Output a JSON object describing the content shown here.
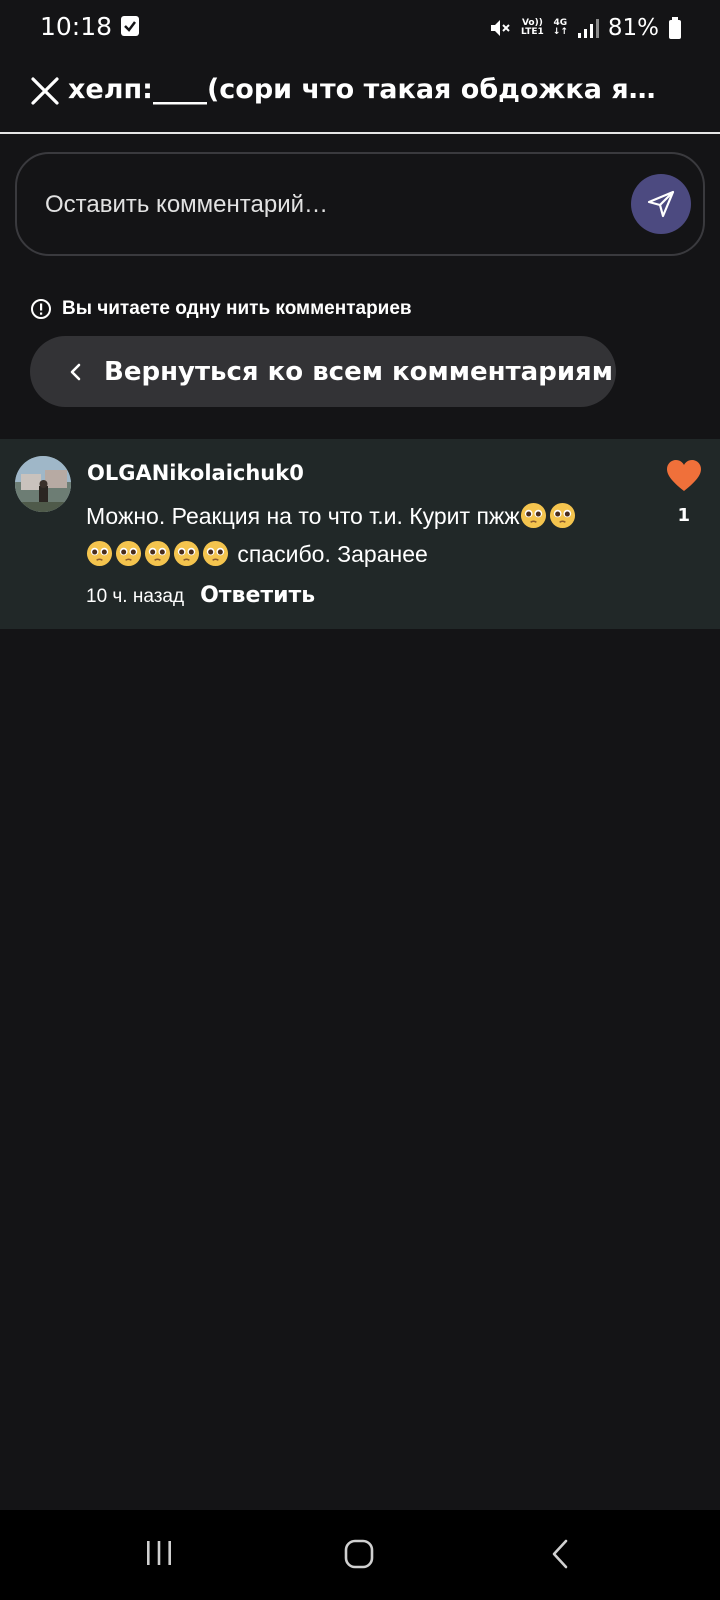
{
  "status_bar": {
    "time": "10:18",
    "network_top": "Vo))",
    "network_bottom": "LTE1",
    "gen": "4G",
    "battery": "81%"
  },
  "header": {
    "title": "хелп:____(сори что такая обдожка я…",
    "close_icon": "close-icon"
  },
  "comment_input": {
    "placeholder": "Оставить комментарий…"
  },
  "thread_notice": {
    "text": "Вы читаете одну нить комментариев"
  },
  "back_button": {
    "label": "Вернуться ко всем комментариям"
  },
  "comment": {
    "username": "OLGANikolaichuk0",
    "text_part1": "Можно. Реакция на то что т.и. Курит пжж",
    "text_part2": "спасибо.  Заранее",
    "timestamp": "10 ч. назад",
    "reply_label": "Ответить",
    "likes": "1",
    "like_color": "#f0703a"
  },
  "colors": {
    "background": "#141416",
    "card": "#212828",
    "send_button": "#4c4a80",
    "pill": "#333336"
  }
}
